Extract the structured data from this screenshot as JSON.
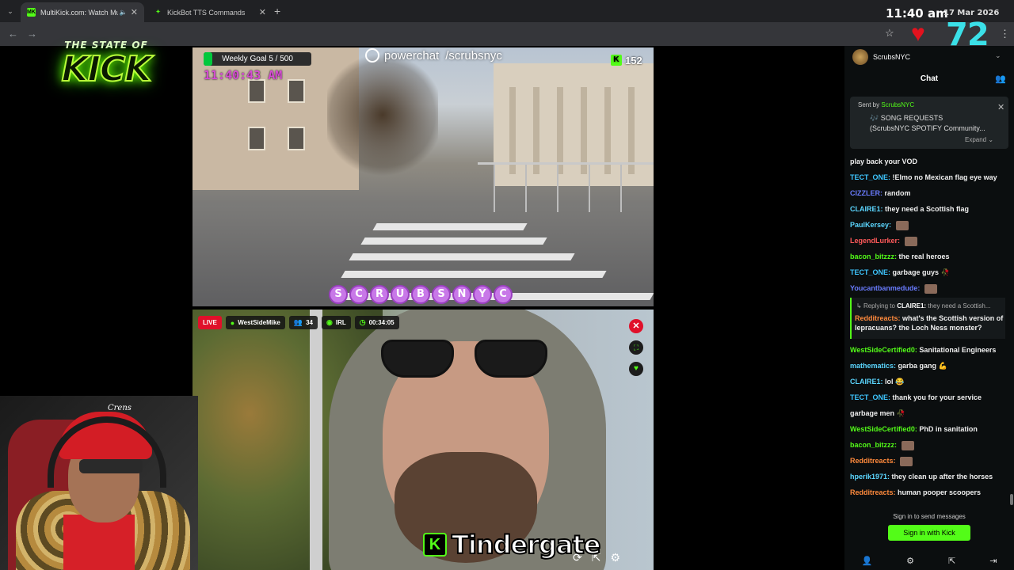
{
  "browser": {
    "tabs": [
      {
        "title": "MultiKick.com: Watch Multi",
        "favicon": "MK",
        "active": true
      },
      {
        "title": "KickBot TTS Commands",
        "favicon": "✦",
        "active": false
      }
    ],
    "new_tab": "+",
    "clock": "11:40 am",
    "date": "17 Mar 2026",
    "viewer_count_big": "72"
  },
  "logo": {
    "top": "THE STATE OF",
    "main": "KICK"
  },
  "stream_top": {
    "weekly_goal": "Weekly Goal 5 / 500",
    "weekly_goal_progress": 0.01,
    "overlay_time": "11:40:43 AM",
    "powerchat": "powerchat",
    "powerchat_handle": "/scrubsnyc",
    "kick_viewers": "152",
    "scrub_letters": [
      "S",
      "C",
      "R",
      "U",
      "B",
      "S",
      "N",
      "Y",
      "C"
    ]
  },
  "stream_bottom": {
    "live": "LIVE",
    "streamer": "WestSideMike",
    "viewers": "34",
    "category": "IRL",
    "uptime": "00:34:05"
  },
  "caption": {
    "icon": "K",
    "text": "Tindergate"
  },
  "webcam": {
    "hat_text": "Crens"
  },
  "chat": {
    "channel": "ScrubsNYC",
    "title": "Chat",
    "pinned": {
      "sent_by": "Sent by",
      "sender": "ScrubsNYC",
      "line1": "🎶 SONG REQUESTS",
      "line2": "(ScrubsNYC SPOTIFY Community...",
      "expand": "Expand ⌄"
    },
    "messages": [
      {
        "user": "",
        "text": "play back your VOD",
        "color": "#efefef"
      },
      {
        "user": "TECT_ONE:",
        "text": "!Elmo no Mexican flag eye way",
        "color": "#3ec6ff"
      },
      {
        "user": "CIZZLER:",
        "text": "random",
        "color": "#6a7cff"
      },
      {
        "user": "CLAIRE1:",
        "text": "they need a Scottish flag",
        "color": "#5bd6ff"
      },
      {
        "user": "PaulKersey:",
        "text": "",
        "color": "#5bd6ff"
      },
      {
        "user": "LegendLurker:",
        "text": "",
        "color": "#ff5a5a"
      },
      {
        "user": "bacon_bitzzz:",
        "text": "the real heroes",
        "color": "#53fc18"
      },
      {
        "user": "TECT_ONE:",
        "text": "garbage guys 🥀",
        "color": "#3ec6ff"
      },
      {
        "user": "Youcantbanmedude:",
        "text": "",
        "color": "#6a7cff"
      }
    ],
    "reply": {
      "label": "Replying to",
      "target": "CLAIRE1:",
      "quote": "they need a Scottish...",
      "user": "Redditreacts:",
      "text": "what's the Scottish version of lepracuans? the Loch Ness monster?"
    },
    "messages2": [
      {
        "user": "WestSideCertified0:",
        "text": "Sanitational Engineers",
        "color": "#53fc18"
      },
      {
        "user": "mathematics:",
        "text": "garba gang 💪",
        "color": "#5bd6ff"
      },
      {
        "user": "CLAIRE1:",
        "text": "lol 😂",
        "color": "#5bd6ff"
      },
      {
        "user": "TECT_ONE:",
        "text": "thank you for your service",
        "color": "#3ec6ff"
      },
      {
        "user": "",
        "text": "garbage men 🥀",
        "color": "#efefef"
      },
      {
        "user": "WestSideCertified0:",
        "text": "PhD in sanitation",
        "color": "#53fc18"
      },
      {
        "user": "bacon_bitzzz:",
        "text": "",
        "color": "#53fc18"
      },
      {
        "user": "Redditreacts:",
        "text": "",
        "color": "#ff8a3c"
      },
      {
        "user": "hperik1971:",
        "text": "they clean up after the horses",
        "color": "#5bd6ff"
      },
      {
        "user": "Redditreacts:",
        "text": "human pooper scoopers",
        "color": "#ff8a3c"
      }
    ],
    "signin_hint": "Sign in to send messages",
    "signin_button": "Sign in with Kick"
  },
  "colors": {
    "kick_green": "#53fc18",
    "live_red": "#e0102a",
    "viewer_cyan": "#3be0e8"
  }
}
